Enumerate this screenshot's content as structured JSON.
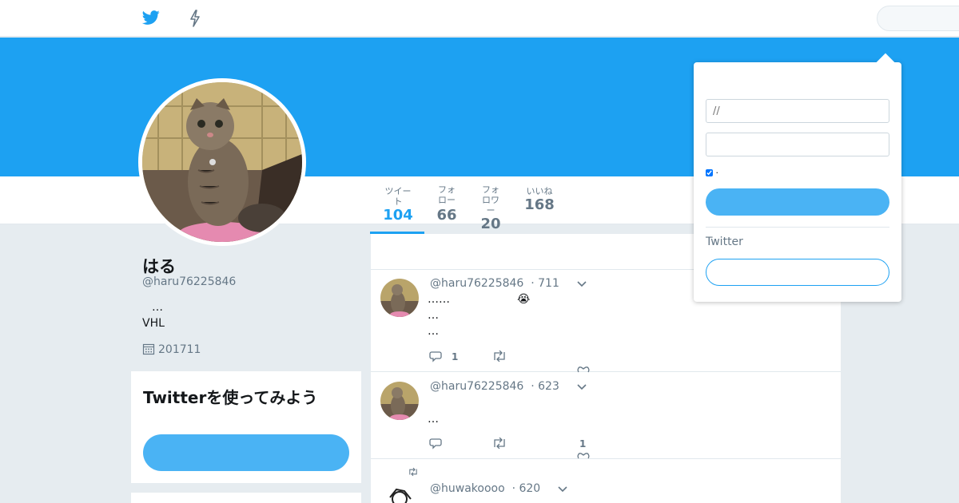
{
  "colors": {
    "accent": "#1da1f2",
    "button_light": "#4ab3f4",
    "muted": "#657786",
    "background": "#e6ecf0"
  },
  "topnav": {
    "home_icon": "twitter-bird-icon",
    "moments_icon": "lightning-icon",
    "search_placeholder": ""
  },
  "profile": {
    "name": "はる",
    "handle": "@haru76225846",
    "bio_line1": "…",
    "bio_line2": "VHL",
    "joined": "201711",
    "avatar_icon": "cat-photo"
  },
  "stats": [
    {
      "label": "ツイート",
      "value": "104",
      "active": true
    },
    {
      "label": "フォロー",
      "value": "66",
      "active": false
    },
    {
      "label": "フォロワー",
      "value": "20",
      "active": false
    },
    {
      "label": "いいね",
      "value": "168",
      "active": false
    }
  ],
  "signup_card": {
    "title": "Twitterを使ってみよう",
    "button_label": ""
  },
  "tweets": [
    {
      "handle": "@haru76225846",
      "date": "· 711",
      "lines": [
        "……",
        "…",
        "…"
      ],
      "emoji": "😭",
      "reply_count": "1",
      "retweet_count": "",
      "like_count": ""
    },
    {
      "handle": "@haru76225846",
      "date": "· 623",
      "lines": [
        "",
        "…"
      ],
      "reply_count": "",
      "retweet_count": "",
      "like_count": "1"
    },
    {
      "handle": "@huwakoooo",
      "date": "· 620",
      "retweeted": true
    }
  ],
  "login": {
    "username_placeholder": "//",
    "password_placeholder": "",
    "remember_label": "·",
    "login_button": "",
    "new_to_twitter": "Twitter",
    "signup_button": ""
  }
}
